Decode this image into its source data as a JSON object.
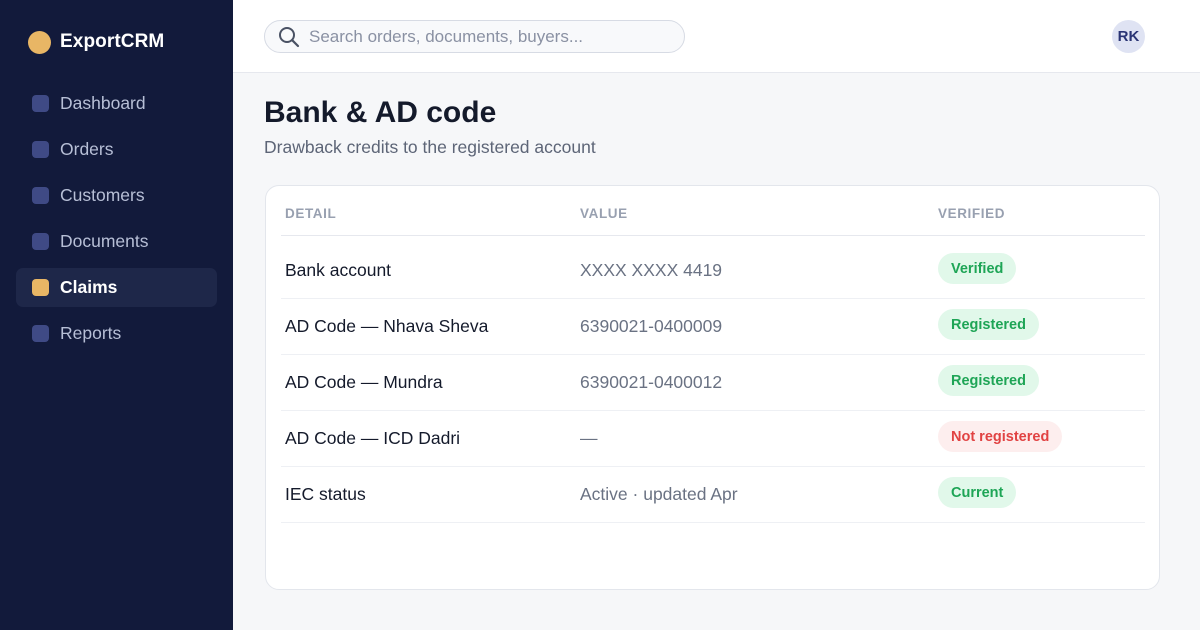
{
  "app": {
    "name": "ExportCRM"
  },
  "sidebar": {
    "items": [
      {
        "label": "Dashboard"
      },
      {
        "label": "Orders"
      },
      {
        "label": "Customers"
      },
      {
        "label": "Documents"
      },
      {
        "label": "Claims",
        "active": true
      },
      {
        "label": "Reports"
      }
    ]
  },
  "search": {
    "placeholder": "Search orders, documents, buyers..."
  },
  "user": {
    "initials": "RK"
  },
  "page": {
    "title": "Bank & AD code",
    "subtitle": "Drawback credits to the registered account"
  },
  "table": {
    "headers": {
      "detail": "DETAIL",
      "value": "VALUE",
      "verified": "VERIFIED"
    },
    "rows": [
      {
        "detail": "Bank account",
        "value": "XXXX XXXX 4419",
        "status": "Verified",
        "status_type": "ok"
      },
      {
        "detail": "AD Code — Nhava Sheva",
        "value": "6390021-0400009",
        "status": "Registered",
        "status_type": "ok"
      },
      {
        "detail": "AD Code — Mundra",
        "value": "6390021-0400012",
        "status": "Registered",
        "status_type": "ok"
      },
      {
        "detail": "AD Code — ICD Dadri",
        "value": "—",
        "status": "Not registered",
        "status_type": "bad"
      },
      {
        "detail": "IEC status",
        "value": "Active · updated Apr",
        "status": "Current",
        "status_type": "ok"
      }
    ]
  },
  "colors": {
    "sidebar_bg": "#121a3b",
    "accent": "#e8b665",
    "success": "#1ea556",
    "danger": "#e14343"
  }
}
